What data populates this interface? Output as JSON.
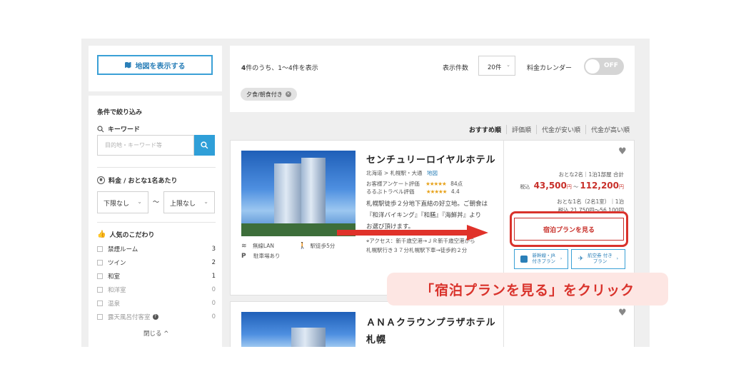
{
  "sidebar": {
    "map_button": "地図を表示する",
    "filter_title": "条件で絞り込み",
    "keyword_label": "キーワード",
    "keyword_placeholder": "目的地・キーワード等",
    "price_label": "料金 / おとな1名あたり",
    "min_price": "下限なし",
    "max_price": "上限なし",
    "tilde": "〜",
    "popular_label": "人気のこだわり",
    "options": [
      {
        "label": "禁煙ルーム",
        "count": "3"
      },
      {
        "label": "ツイン",
        "count": "2"
      },
      {
        "label": "和室",
        "count": "1"
      },
      {
        "label": "和洋室",
        "count": "0"
      },
      {
        "label": "温泉",
        "count": "0"
      },
      {
        "label": "露天風呂付客室",
        "count": "0"
      }
    ],
    "collapse": "閉じる ^"
  },
  "topbar": {
    "result_count_bold": "4",
    "result_count_text": "件のうち、1〜4件を表示",
    "per_page_label": "表示件数",
    "per_page_value": "20件",
    "calendar_label": "料金カレンダー",
    "calendar_toggle": "OFF",
    "active_filter": "夕食/朝食付き"
  },
  "sort": [
    "おすすめ順",
    "評価順",
    "代金が安い順",
    "代金が高い順"
  ],
  "hotels": [
    {
      "name": "センチュリーロイヤルホテル",
      "location": "北海道 > 札幌駅・大通",
      "map_link": "地図",
      "rating1_label": "お客様アンケート評価",
      "rating1_stars": "★★★★★",
      "rating1_value": "84点",
      "rating2_label": "るるぶトラベル評価",
      "rating2_stars": "★★★★★",
      "rating2_value": "4.4",
      "desc1": "札幌駅徒歩２分地下直結の好立地。ご朝食は",
      "desc2": "『和洋バイキング』『和膳』『海鮮丼』より",
      "desc3": "お選び頂けます。",
      "amenity1": "無線LAN",
      "amenity2": "駅徒歩5分",
      "amenity3": "駐車場あり",
      "access1": "アクセス：新千歳空港→ＪＲ新千歳空港から",
      "access2": "札幌駅行き３７分札幌駅下車→徒歩約２分",
      "guests": "おとな2名｜1泊1部屋 合計",
      "tax_label": "税込",
      "price_low": "43,500",
      "yen": "円",
      "tilde": "〜",
      "price_high": "112,200",
      "per_person": "おとな1名（2名1室）｜1泊",
      "per_person_price": "税込 21,750円〜56,100円",
      "plan_button": "宿泊プランを見る",
      "rail_button": "新幹線・JR 付きプラン",
      "air_button": "航空券 付きプラン"
    },
    {
      "name": "ＡＮＡクラウンプラザホテル",
      "name2": "札幌"
    }
  ],
  "callout": "「宿泊プランを見る」をクリック",
  "colors": {
    "accent_blue": "#2f9fd8",
    "accent_red": "#d9322b",
    "price_red": "#c8302a"
  }
}
